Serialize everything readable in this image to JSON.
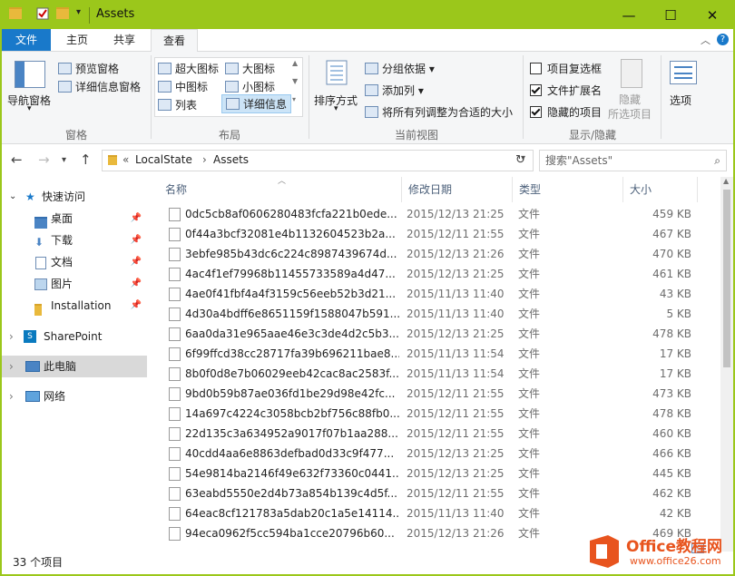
{
  "window": {
    "title": "Assets",
    "minimize": "—",
    "maximize": "☐",
    "close": "✕"
  },
  "tabs": [
    {
      "label": "文件"
    },
    {
      "label": "主页"
    },
    {
      "label": "共享"
    },
    {
      "label": "查看"
    }
  ],
  "ribbon": {
    "panes": {
      "label": "窗格",
      "nav_pane": "导航窗格",
      "preview_pane": "预览窗格",
      "details_pane": "详细信息窗格"
    },
    "layout": {
      "label": "布局",
      "extra_large": "超大图标",
      "large": "大图标",
      "medium": "中图标",
      "small": "小图标",
      "list": "列表",
      "details": "详细信息"
    },
    "current_view": {
      "label": "当前视图",
      "sort_by": "排序方式",
      "group_by": "分组依据",
      "add_column": "添加列",
      "size_all_columns": "将所有列调整为合适的大小"
    },
    "show_hide": {
      "label": "显示/隐藏",
      "item_checkboxes": "项目复选框",
      "item_checkboxes_checked": false,
      "file_extensions": "文件扩展名",
      "file_extensions_checked": true,
      "hidden_items": "隐藏的项目",
      "hidden_items_checked": true,
      "hide_selected_line1": "隐藏",
      "hide_selected_line2": "所选项目"
    },
    "options": "选项"
  },
  "address": {
    "path_prefix": "«",
    "crumb1": "LocalState",
    "crumb2": "Assets",
    "search_placeholder": "搜索\"Assets\""
  },
  "nav_pane": {
    "quick_access": "快速访问",
    "items": [
      {
        "label": "桌面"
      },
      {
        "label": "下载"
      },
      {
        "label": "文档"
      },
      {
        "label": "图片"
      },
      {
        "label": "Installation"
      }
    ],
    "sharepoint": "SharePoint",
    "this_pc": "此电脑",
    "network": "网络"
  },
  "columns": {
    "name": "名称",
    "date": "修改日期",
    "type": "类型",
    "size": "大小"
  },
  "files": [
    {
      "name": "0dc5cb8af0606280483fcfa221b0ede...",
      "date": "2015/12/13 21:25",
      "type": "文件",
      "size": "459 KB"
    },
    {
      "name": "0f44a3bcf32081e4b1132604523b2a...",
      "date": "2015/12/11 21:55",
      "type": "文件",
      "size": "467 KB"
    },
    {
      "name": "3ebfe985b43dc6c224c8987439674d...",
      "date": "2015/12/13 21:26",
      "type": "文件",
      "size": "470 KB"
    },
    {
      "name": "4ac4f1ef79968b11455733589a4d47...",
      "date": "2015/12/13 21:25",
      "type": "文件",
      "size": "461 KB"
    },
    {
      "name": "4ae0f41fbf4a4f3159c56eeb52b3d21...",
      "date": "2015/11/13 11:40",
      "type": "文件",
      "size": "43 KB"
    },
    {
      "name": "4d30a4bdff6e8651159f1588047b591...",
      "date": "2015/11/13 11:40",
      "type": "文件",
      "size": "5 KB"
    },
    {
      "name": "6aa0da31e965aae46e3c3de4d2c5b3...",
      "date": "2015/12/13 21:25",
      "type": "文件",
      "size": "478 KB"
    },
    {
      "name": "6f99ffcd38cc28717fa39b696211bae8...",
      "date": "2015/11/13 11:54",
      "type": "文件",
      "size": "17 KB"
    },
    {
      "name": "8b0f0d8e7b06029eeb42cac8ac2583f...",
      "date": "2015/11/13 11:54",
      "type": "文件",
      "size": "17 KB"
    },
    {
      "name": "9bd0b59b87ae036fd1be29d98e42fc...",
      "date": "2015/12/11 21:55",
      "type": "文件",
      "size": "473 KB"
    },
    {
      "name": "14a697c4224c3058bcb2bf756c88fb0...",
      "date": "2015/12/11 21:55",
      "type": "文件",
      "size": "478 KB"
    },
    {
      "name": "22d135c3a634952a9017f07b1aa288...",
      "date": "2015/12/11 21:55",
      "type": "文件",
      "size": "460 KB"
    },
    {
      "name": "40cdd4aa6e8863defbad0d33c9f477...",
      "date": "2015/12/13 21:25",
      "type": "文件",
      "size": "466 KB"
    },
    {
      "name": "54e9814ba2146f49e632f73360c0441...",
      "date": "2015/12/13 21:25",
      "type": "文件",
      "size": "445 KB"
    },
    {
      "name": "63eabd5550e2d4b73a854b139c4d5f...",
      "date": "2015/12/11 21:55",
      "type": "文件",
      "size": "462 KB"
    },
    {
      "name": "64eac8cf121783a5dab20c1a5e14114...",
      "date": "2015/11/13 11:40",
      "type": "文件",
      "size": "42 KB"
    },
    {
      "name": "94eca0962f5cc594ba1cce20796b60...",
      "date": "2015/12/13 21:26",
      "type": "文件",
      "size": "469 KB"
    }
  ],
  "status": {
    "item_count": "33 个项目"
  },
  "watermark": {
    "text": "Office教程网",
    "url": "www.office26.com"
  }
}
